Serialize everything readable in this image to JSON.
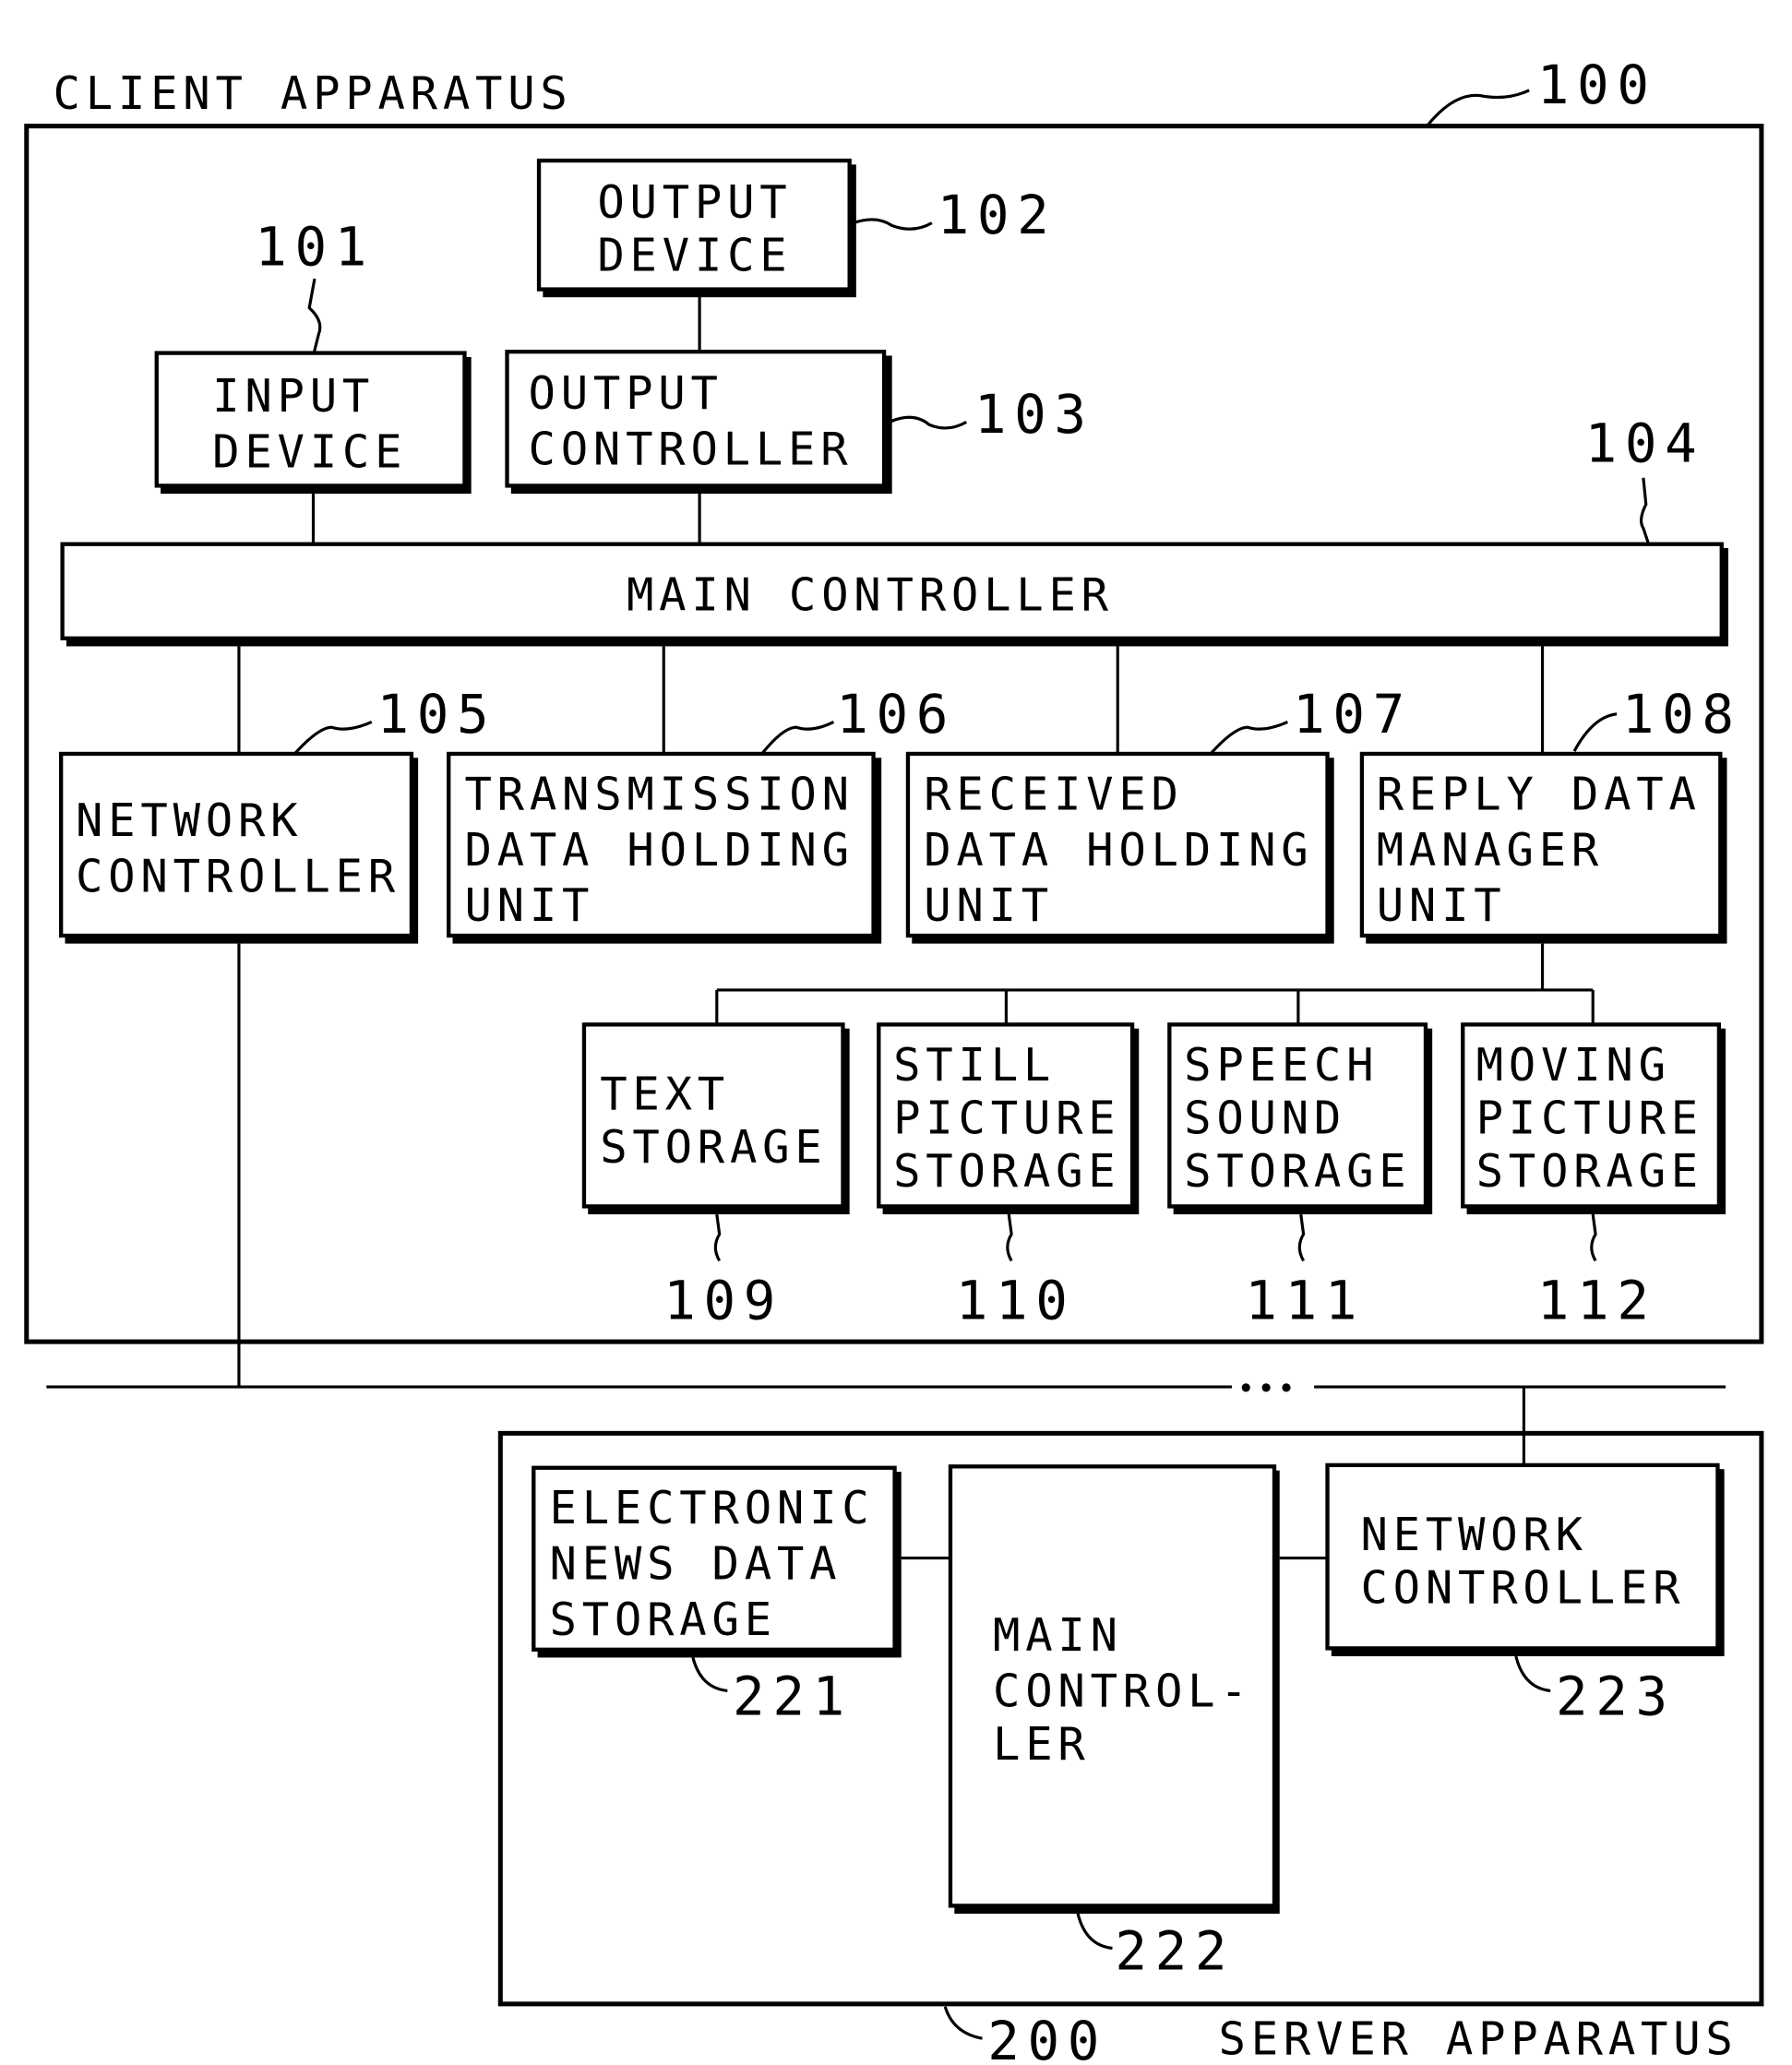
{
  "figure": {
    "client": {
      "label": "CLIENT APPARATUS",
      "ref": "100",
      "blocks": {
        "input_device": {
          "lines": [
            "INPUT",
            "DEVICE"
          ],
          "ref": "101"
        },
        "output_device": {
          "lines": [
            "OUTPUT",
            "DEVICE"
          ],
          "ref": "102"
        },
        "output_controller": {
          "lines": [
            "OUTPUT",
            "CONTROLLER"
          ],
          "ref": "103"
        },
        "main_controller": {
          "lines": [
            "MAIN CONTROLLER"
          ],
          "ref": "104"
        },
        "network_controller": {
          "lines": [
            "NETWORK",
            "CONTROLLER"
          ],
          "ref": "105"
        },
        "transmission_data_holding": {
          "lines": [
            "TRANSMISSION",
            "DATA HOLDING",
            "UNIT"
          ],
          "ref": "106"
        },
        "received_data_holding": {
          "lines": [
            "RECEIVED",
            "DATA HOLDING",
            "UNIT"
          ],
          "ref": "107"
        },
        "reply_data_manager": {
          "lines": [
            "REPLY DATA",
            "MANAGER",
            "UNIT"
          ],
          "ref": "108"
        },
        "text_storage": {
          "lines": [
            "TEXT",
            "STORAGE"
          ],
          "ref": "109"
        },
        "still_picture_storage": {
          "lines": [
            "STILL",
            "PICTURE",
            "STORAGE"
          ],
          "ref": "110"
        },
        "speech_sound_storage": {
          "lines": [
            "SPEECH",
            "SOUND",
            "STORAGE"
          ],
          "ref": "111"
        },
        "moving_picture_storage": {
          "lines": [
            "MOVING",
            "PICTURE",
            "STORAGE"
          ],
          "ref": "112"
        }
      }
    },
    "network": {
      "ellipsis": "•••"
    },
    "server": {
      "label": "SERVER APPARATUS",
      "ref": "200",
      "blocks": {
        "electronic_news_data_storage": {
          "lines": [
            "ELECTRONIC",
            "NEWS DATA",
            "STORAGE"
          ],
          "ref": "221"
        },
        "main_controller": {
          "lines": [
            "MAIN",
            "CONTROL-",
            "LER"
          ],
          "ref": "222"
        },
        "network_controller": {
          "lines": [
            "NETWORK",
            "CONTROLLER"
          ],
          "ref": "223"
        }
      }
    }
  }
}
